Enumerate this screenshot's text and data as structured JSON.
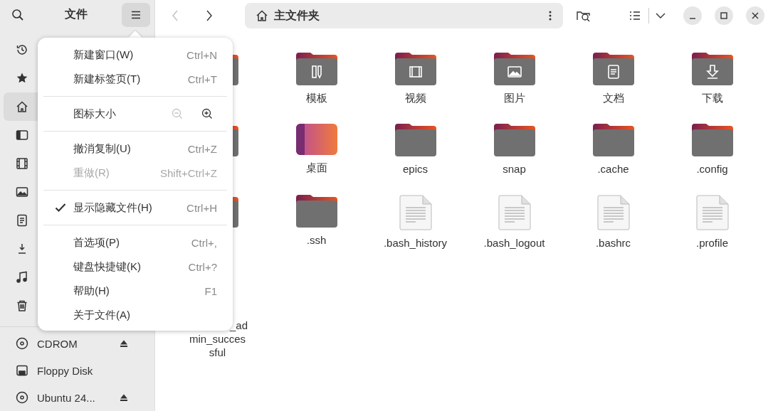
{
  "sidebar": {
    "title": "文件",
    "menu_button": {
      "pressed": true
    },
    "places": [
      {
        "kind": "recent",
        "selected": false
      },
      {
        "kind": "starred",
        "selected": false
      },
      {
        "kind": "home",
        "selected": true
      },
      {
        "kind": "desktop",
        "selected": false
      },
      {
        "kind": "video",
        "selected": false
      },
      {
        "kind": "picture",
        "selected": false
      },
      {
        "kind": "document",
        "selected": false
      },
      {
        "kind": "download",
        "selected": false
      },
      {
        "kind": "music",
        "selected": false
      },
      {
        "kind": "trash",
        "selected": false
      }
    ],
    "devices": [
      {
        "kind": "disc",
        "label": "CDROM",
        "eject": true,
        "selected": false
      },
      {
        "kind": "floppy",
        "label": "Floppy Disk",
        "eject": false,
        "selected": false
      },
      {
        "kind": "disc",
        "label": "Ubuntu 24...",
        "eject": true,
        "selected": false
      }
    ]
  },
  "nav": {
    "back": {
      "disabled": true
    },
    "forward": {
      "disabled": false
    }
  },
  "path": {
    "label": "主文件夹"
  },
  "files": [
    {
      "kind": "folder"
    },
    {
      "kind": "template-folder",
      "name": "模板"
    },
    {
      "kind": "video-folder",
      "name": "视频"
    },
    {
      "kind": "picture-folder",
      "name": "图片"
    },
    {
      "kind": "document-folder",
      "name": "文档"
    },
    {
      "kind": "download-folder",
      "name": "下载"
    },
    {
      "kind": "folder"
    },
    {
      "kind": "desktop",
      "name": "桌面"
    },
    {
      "kind": "folder",
      "name": "epics"
    },
    {
      "kind": "folder",
      "name": "snap"
    },
    {
      "kind": "folder",
      "name": ".cache"
    },
    {
      "kind": "folder",
      "name": ".config"
    },
    {
      "kind": "folder"
    },
    {
      "kind": "folder",
      "name": ".ssh"
    },
    {
      "kind": "text",
      "name": ".bash_history"
    },
    {
      "kind": "text",
      "name": ".bash_logout"
    },
    {
      "kind": "text",
      "name": ".bashrc"
    },
    {
      "kind": "text",
      "name": ".profile"
    },
    {
      "kind": "hidden",
      "name": "_admin_successful"
    }
  ],
  "menu": [
    {
      "kind": "item",
      "label": "新建窗口(W)",
      "shortcut": "Ctrl+N",
      "disabled": false
    },
    {
      "kind": "item",
      "label": "新建标签页(T)",
      "shortcut": "Ctrl+T",
      "disabled": false
    },
    {
      "kind": "separator"
    },
    {
      "kind": "zoom",
      "label": "图标大小",
      "zoom_out_disabled": true
    },
    {
      "kind": "separator"
    },
    {
      "kind": "item",
      "label": "撤消复制(U)",
      "shortcut": "Ctrl+Z",
      "disabled": false
    },
    {
      "kind": "item",
      "label": "重做(R)",
      "shortcut": "Shift+Ctrl+Z",
      "disabled": true
    },
    {
      "kind": "separator"
    },
    {
      "kind": "check",
      "label": "显示隐藏文件(H)",
      "shortcut": "Ctrl+H",
      "checked": true
    },
    {
      "kind": "separator"
    },
    {
      "kind": "item",
      "label": "首选项(P)",
      "shortcut": "Ctrl+,",
      "disabled": false
    },
    {
      "kind": "item",
      "label": "键盘快捷键(K)",
      "shortcut": "Ctrl+?",
      "disabled": false
    },
    {
      "kind": "item",
      "label": "帮助(H)",
      "shortcut": "F1",
      "disabled": false
    },
    {
      "kind": "item",
      "label": "关于文件(A)",
      "disabled": false
    }
  ]
}
